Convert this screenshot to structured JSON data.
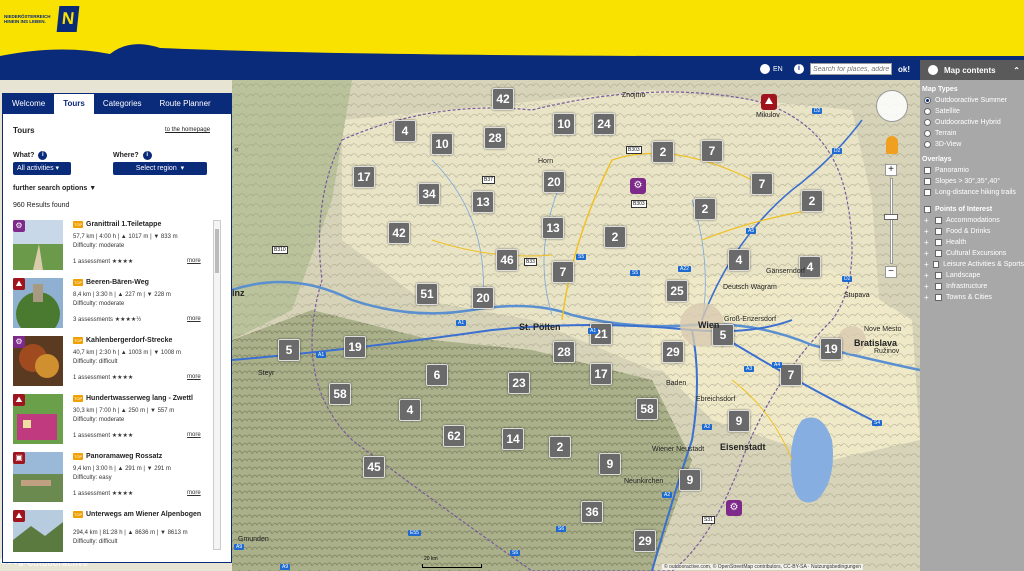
{
  "header": {
    "logo_text": "NIEDERÖSTERREICH HINEIN INS LEBEN.",
    "logo_letter": "N",
    "lang": "EN",
    "search_placeholder": "Search for places, addresses",
    "ok_label": "ok!"
  },
  "panel": {
    "tabs": [
      "Welcome",
      "Tours",
      "Categories",
      "Route Planner"
    ],
    "active_tab": "Tours",
    "title": "Tours",
    "home_link": "to the homepage",
    "what_label": "What?",
    "what_value": "All activities",
    "where_label": "Where?",
    "where_value": "Select region",
    "more_options": "further search options ▼",
    "results": "960 Results found",
    "items": [
      {
        "type": "bike",
        "badge": "TOP",
        "title": "Granittrail 1.Teiletappe",
        "stats": "57,7 km | 4:00 h | ▲ 1017 m | ▼ 833 m",
        "difficulty": "Difficulty: moderate",
        "assessment": "1 assessment",
        "stars": "★★★★",
        "more": "more"
      },
      {
        "type": "hike",
        "badge": "TOP",
        "title": "Beeren-Bären-Weg",
        "stats": "8,4 km | 3:30 h | ▲ 227 m | ▼ 228 m",
        "difficulty": "Difficulty: moderate",
        "assessment": "3 assessments",
        "stars": "★★★★½",
        "more": "more"
      },
      {
        "type": "bike",
        "badge": "TOP",
        "title": "Kahlenbergerdorf-Strecke",
        "stats": "40,7 km | 2:30 h | ▲ 1003 m | ▼ 1008 m",
        "difficulty": "Difficulty: difficult",
        "assessment": "1 assessment",
        "stars": "★★★★",
        "more": "more"
      },
      {
        "type": "hike",
        "badge": "TOP",
        "title": "Hundertwasserweg lang - Zwettl",
        "stats": "30,3 km | 7:00 h | ▲ 250 m | ▼ 557 m",
        "difficulty": "Difficulty: moderate",
        "assessment": "1 assessment",
        "stars": "★★★★",
        "more": "more"
      },
      {
        "type": "car",
        "badge": "TOP",
        "title": "Panoramaweg Rossatz",
        "stats": "9,4 km | 3:00 h | ▲ 291 m | ▼ 291 m",
        "difficulty": "Difficulty: easy",
        "assessment": "1 assessment",
        "stars": "★★★★",
        "more": "more"
      },
      {
        "type": "hike",
        "badge": "TOP",
        "title": "Unterwegs am Wiener Alpenbogen",
        "stats": "294,4 km | 81:28 h | ▲ 8636 m | ▼ 8613 m",
        "difficulty": "Difficulty: difficult",
        "assessment": "",
        "stars": "",
        "more": ""
      }
    ]
  },
  "right_panel": {
    "title": "Map contents",
    "map_types_title": "Map Types",
    "map_types": [
      "Outdooractive Summer",
      "Satellite",
      "Outdooractive Hybrid",
      "Terrain",
      "3D-View"
    ],
    "overlays_title": "Overlays",
    "overlays": [
      "Panoramio",
      "Slopes > 30°,35°,40°",
      "Long-distance hiking trails"
    ],
    "poi_title": "Points of Interest",
    "poi": [
      "Accommodations",
      "Food & Drinks",
      "Health",
      "Cultural Excursions",
      "Leisure Activities & Sports",
      "Landscape",
      "Infrastructure",
      "Towns & Cities"
    ]
  },
  "map": {
    "clusters": [
      {
        "n": "42"
      },
      {
        "n": "10"
      },
      {
        "n": "24"
      },
      {
        "n": "4"
      },
      {
        "n": "28"
      },
      {
        "n": "10"
      },
      {
        "n": "2"
      },
      {
        "n": "7"
      },
      {
        "n": "17"
      },
      {
        "n": "34"
      },
      {
        "n": "13"
      },
      {
        "n": "20"
      },
      {
        "n": "7"
      },
      {
        "n": "2"
      },
      {
        "n": "2"
      },
      {
        "n": "42"
      },
      {
        "n": "13"
      },
      {
        "n": "46"
      },
      {
        "n": "7"
      },
      {
        "n": "2"
      },
      {
        "n": "4"
      },
      {
        "n": "4"
      },
      {
        "n": "51"
      },
      {
        "n": "20"
      },
      {
        "n": "25"
      },
      {
        "n": "21"
      },
      {
        "n": "28"
      },
      {
        "n": "5"
      },
      {
        "n": "29"
      },
      {
        "n": "19"
      },
      {
        "n": "5"
      },
      {
        "n": "19"
      },
      {
        "n": "6"
      },
      {
        "n": "17"
      },
      {
        "n": "23"
      },
      {
        "n": "7"
      },
      {
        "n": "58"
      },
      {
        "n": "4"
      },
      {
        "n": "58"
      },
      {
        "n": "62"
      },
      {
        "n": "14"
      },
      {
        "n": "9"
      },
      {
        "n": "2"
      },
      {
        "n": "45"
      },
      {
        "n": "9"
      },
      {
        "n": "9"
      },
      {
        "n": "36"
      },
      {
        "n": "29"
      }
    ],
    "places": [
      "Znojmo",
      "Mikulov",
      "Horn",
      "Gänserndorf",
      "Stupava",
      "Deutsch Wagram",
      "Groß-Enzersdorf",
      "Wien",
      "Bratislava",
      "Nove Mesto",
      "Ružinov",
      "St. Pölten",
      "Baden",
      "Ebreichsdorf",
      "Eisenstadt",
      "Wiener Neustadt",
      "Neunkirchen",
      "Steyr",
      "inz",
      "Gmunden"
    ],
    "roads": [
      "B303",
      "B303",
      "B33",
      "S5",
      "S5",
      "A22",
      "A5",
      "D2",
      "D2",
      "D2",
      "A1",
      "A1",
      "A1",
      "A3",
      "A4",
      "A2",
      "A2",
      "S6",
      "S6",
      "A9",
      "A9",
      "S31",
      "S4",
      "B310",
      "E55",
      "B37"
    ],
    "scale": "20 km",
    "copyright": "© outdooractive.com, © OpenStreetMap contributors, CC-BY-SA · Nutzungsbedingungen"
  },
  "footer": {
    "google": "Google",
    "oa": "outdooractive"
  },
  "colors": {
    "yellow": "#f9e100",
    "navy": "#0a2a7a",
    "cluster": "#6a6a6a",
    "hike": "#a0141e",
    "bike": "#7d2a8a"
  }
}
